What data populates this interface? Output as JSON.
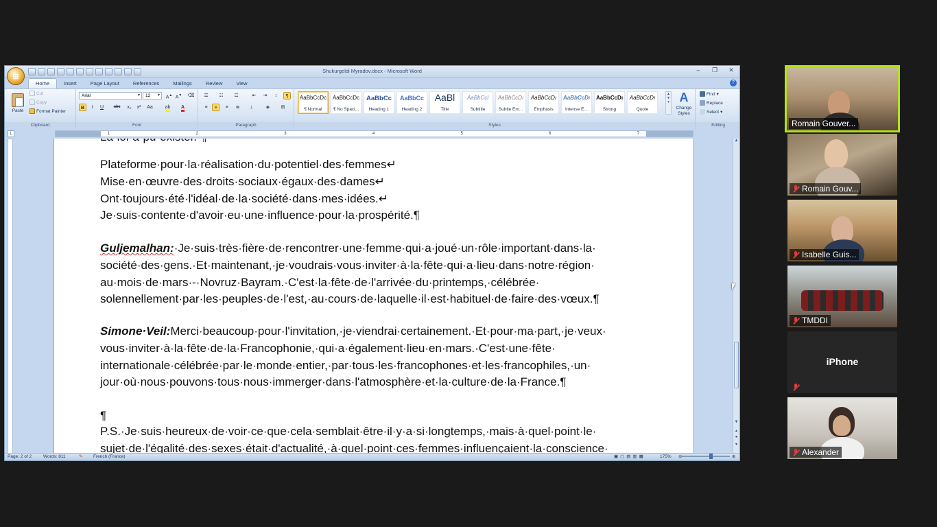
{
  "word": {
    "title": "Shukurgeldi Myradov.docx - Microsoft Word",
    "office_button": "⊞",
    "window_controls": [
      "–",
      "❐",
      "✕"
    ],
    "tabs": [
      "Home",
      "Insert",
      "Page Layout",
      "References",
      "Mailings",
      "Review",
      "View"
    ],
    "active_tab": "Home",
    "clipboard": {
      "paste": "Paste",
      "cut": "Cut",
      "copy": "Copy",
      "format_painter": "Format Painter",
      "label": "Clipboard"
    },
    "font": {
      "name": "Arial",
      "size": "12",
      "buttons": [
        "B",
        "I",
        "U",
        "abc",
        "x₂",
        "x²",
        "Aa"
      ],
      "label": "Font"
    },
    "paragraph": {
      "label": "Paragraph"
    },
    "styles": {
      "items": [
        {
          "sample": "AaBbCcDc",
          "name": "¶ Normal"
        },
        {
          "sample": "AaBbCcDc",
          "name": "¶ No Spaci..."
        },
        {
          "sample": "AaBbCc",
          "name": "Heading 1"
        },
        {
          "sample": "AaBbCc",
          "name": "Heading 2"
        },
        {
          "sample": "AaBl",
          "name": "Title"
        },
        {
          "sample": "AaBbCcl",
          "name": "Subtitle"
        },
        {
          "sample": "AaBbCcDı",
          "name": "Subtle Em..."
        },
        {
          "sample": "AaBbCcDı",
          "name": "Emphasis"
        },
        {
          "sample": "AaBbCcDı",
          "name": "Intense E..."
        },
        {
          "sample": "AaBbCcDı",
          "name": "Strong"
        },
        {
          "sample": "AaBbCcDı",
          "name": "Quote"
        }
      ],
      "change_styles": "Change Styles",
      "label": "Styles"
    },
    "editing": {
      "find": "Find",
      "replace": "Replace",
      "select": "Select",
      "label": "Editing"
    },
    "ruler_numbers": [
      "1",
      "2",
      "3",
      "4",
      "5",
      "6",
      "7"
    ],
    "document": {
      "top_partial": "La loi a pu exister. ¶",
      "poem": [
        "Plateforme·pour·la·réalisation·du·potentiel·des·femmes↵",
        "Mise·en·œuvre·des·droits·sociaux·égaux·des·dames↵",
        "Ont·toujours·été·l'idéal·de·la·société·dans·mes·idées.↵",
        "Je·suis·contente·d'avoir·eu·une·influence·pour·la·prospérité.¶"
      ],
      "p1_speaker": "Guljemalhan:",
      "p1_lines": [
        "·Je·suis·très·fière·de·rencontrer·une·femme·qui·a·joué·un·rôle·important·dans·la·",
        "société·des·gens.·Et·maintenant,·je·voudrais·vous·inviter·à·la·fête·qui·a·lieu·dans·notre·région·",
        "au·mois·de·mars·-·Novruz·Bayram.·C'est·la·fête·de·l'arrivée·du·printemps,·célébrée·",
        "solennellement·par·les·peuples·de·l'est,·au·cours·de·laquelle·il·est·habituel·de·faire·des·vœux.¶"
      ],
      "p2_speaker": "Simone·Veil:",
      "p2_lines": [
        "Merci·beaucoup·pour·l'invitation,·je·viendrai·certainement.·Et·pour·ma·part,·je·veux·",
        "vous·inviter·à·la·fête·de·la·Francophonie,·qui·a·également·lieu·en·mars.·C'est·une·fête·",
        "internationale·célébrée·par·le·monde·entier,·par·tous·les·francophones·et·les·francophiles,·un·",
        "jour·où·nous·pouvons·tous·nous·immerger·dans·l'atmosphère·et·la·culture·de·la·France.¶"
      ],
      "empty_para": "¶",
      "ps_lines": [
        "P.S.·Je·suis·heureux·de·voir·ce·que·cela·semblait·être·il·y·a·si·longtemps,·mais·à·quel·point·le·",
        "sujet·de·l'égalité·des·sexes·était·d'actualité,·à·quel·point·ces·femmes·influençaient·la·conscience·"
      ]
    },
    "status": {
      "page": "Page: 2 of 2",
      "words": "Words: 811",
      "language": "French (France)",
      "zoom": "175%"
    }
  },
  "participants": [
    {
      "name": "Romain Gouver...",
      "muted": false,
      "active": true
    },
    {
      "name": "Romain Gouv...",
      "muted": true
    },
    {
      "name": "Isabelle Guis...",
      "muted": true
    },
    {
      "name": "TMDDI",
      "muted": true
    },
    {
      "name": "",
      "device": "iPhone",
      "muted": true
    },
    {
      "name": "Alexander",
      "muted": true
    }
  ]
}
